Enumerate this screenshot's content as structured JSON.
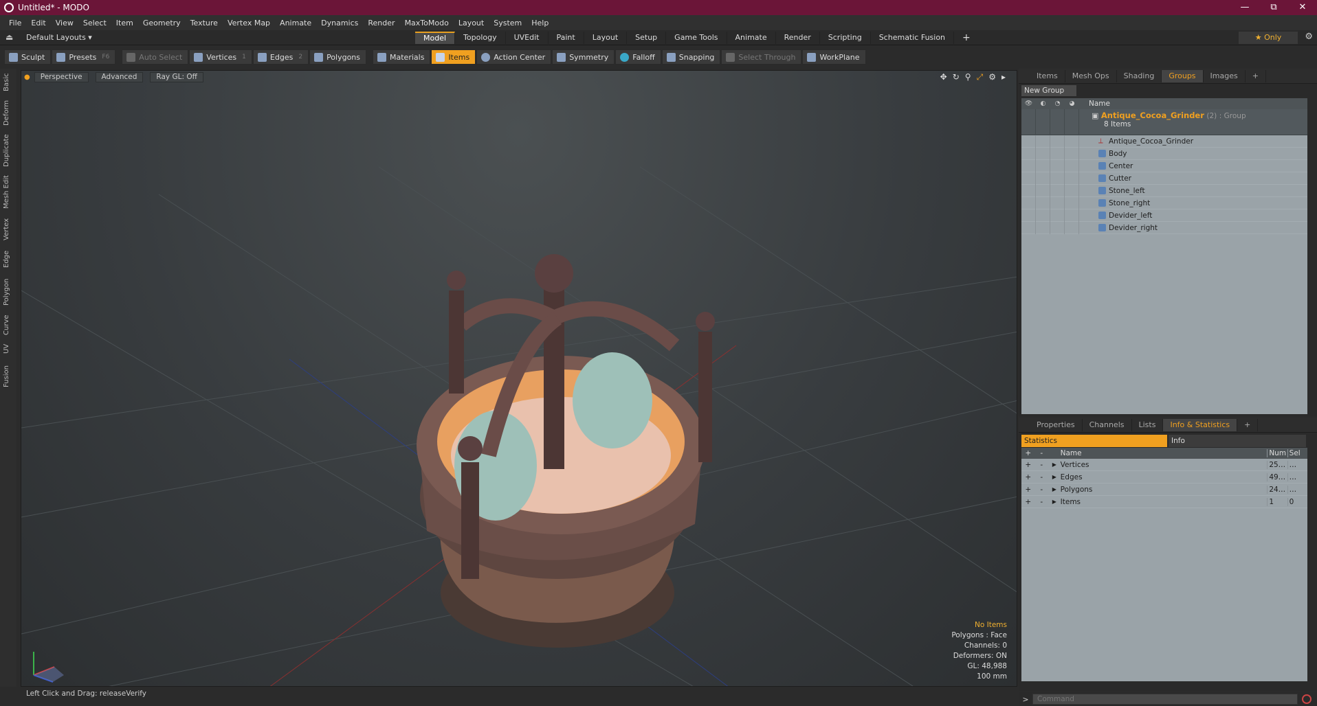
{
  "window": {
    "title": "Untitled* - MODO",
    "controls": [
      "—",
      "⧉",
      "✕"
    ]
  },
  "menu": [
    "File",
    "Edit",
    "View",
    "Select",
    "Item",
    "Geometry",
    "Texture",
    "Vertex Map",
    "Animate",
    "Dynamics",
    "Render",
    "MaxToModo",
    "Layout",
    "System",
    "Help"
  ],
  "layoutbar": {
    "layout_select": "Default Layouts ▾",
    "tabs": [
      "Model",
      "Topology",
      "UVEdit",
      "Paint",
      "Layout",
      "Setup",
      "Game Tools",
      "Animate",
      "Render",
      "Scripting",
      "Schematic Fusion"
    ],
    "active_tab": "Model",
    "only_label": "★  Only"
  },
  "toolbar": {
    "sculpt": "Sculpt",
    "presets": "Presets",
    "presets_key": "F6",
    "auto_select": "Auto Select",
    "vertices": "Vertices",
    "vertices_key": "1",
    "edges": "Edges",
    "edges_key": "2",
    "polygons": "Polygons",
    "materials": "Materials",
    "items": "Items",
    "action_center": "Action Center",
    "symmetry": "Symmetry",
    "falloff": "Falloff",
    "snapping": "Snapping",
    "select_through": "Select Through",
    "workplane": "WorkPlane"
  },
  "left_tabs": [
    "Basic",
    "Deform",
    "Duplicate",
    "Mesh Edit",
    "Vertex",
    "Edge",
    "Polygon",
    "Curve",
    "UV",
    "Fusion"
  ],
  "viewport": {
    "perspective": "Perspective",
    "advanced": "Advanced",
    "raygl": "Ray GL: Off",
    "info": {
      "items": "No Items",
      "polygons": "Polygons : Face",
      "channels": "Channels: 0",
      "deformers": "Deformers: ON",
      "gl": "GL: 48,988",
      "scale": "100 mm"
    }
  },
  "status": "Left Click and Drag:   releaseVerify",
  "top_panel": {
    "tabs": [
      "Items",
      "Mesh Ops",
      "Shading",
      "Groups",
      "Images",
      "+"
    ],
    "active_tab": "Groups",
    "new_group": "New Group",
    "name_header": "Name",
    "group": {
      "name": "Antique_Cocoa_Grinder",
      "count": "(2)",
      "type": ": Group",
      "items_count": "8 Items"
    },
    "children": [
      "Antique_Cocoa_Grinder",
      "Body",
      "Center",
      "Cutter",
      "Stone_left",
      "Stone_right",
      "Devider_left",
      "Devider_right"
    ]
  },
  "bottom_panel": {
    "tabs": [
      "Properties",
      "Channels",
      "Lists",
      "Info & Statistics",
      "+"
    ],
    "active_tab": "Info & Statistics",
    "subtab_statistics": "Statistics",
    "subtab_info": "Info",
    "headers": {
      "name": "Name",
      "num": "Num",
      "sel": "Sel"
    },
    "rows": [
      {
        "name": "Vertices",
        "num": "25…",
        "sel": "…"
      },
      {
        "name": "Edges",
        "num": "49…",
        "sel": "…"
      },
      {
        "name": "Polygons",
        "num": "24…",
        "sel": "…"
      },
      {
        "name": "Items",
        "num": "1",
        "sel": "0"
      }
    ]
  },
  "command": {
    "placeholder": "Command"
  }
}
